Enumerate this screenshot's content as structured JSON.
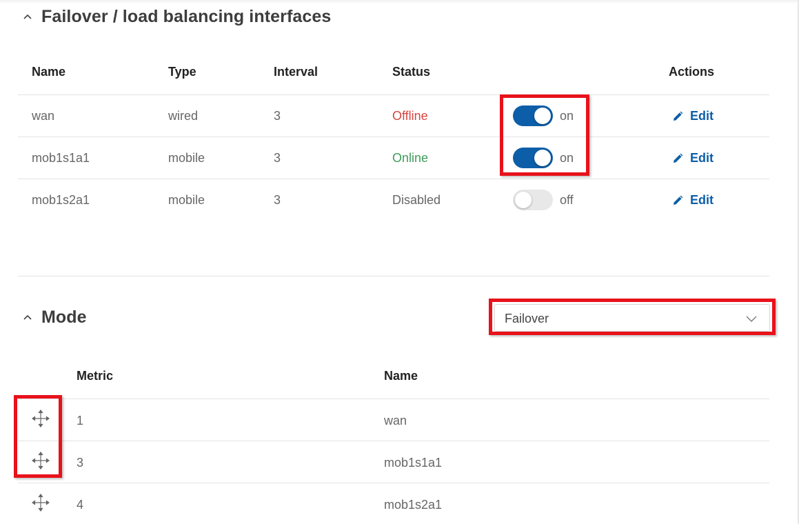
{
  "failover_section": {
    "title": "Failover / load balancing interfaces",
    "columns": {
      "name": "Name",
      "type": "Type",
      "interval": "Interval",
      "status": "Status",
      "actions": "Actions"
    },
    "rows": [
      {
        "name": "wan",
        "type": "wired",
        "interval": "3",
        "status": "Offline",
        "toggle": "on",
        "enabled": true,
        "edit": "Edit"
      },
      {
        "name": "mob1s1a1",
        "type": "mobile",
        "interval": "3",
        "status": "Online",
        "toggle": "on",
        "enabled": true,
        "edit": "Edit"
      },
      {
        "name": "mob1s2a1",
        "type": "mobile",
        "interval": "3",
        "status": "Disabled",
        "toggle": "off",
        "enabled": false,
        "edit": "Edit"
      }
    ]
  },
  "mode_section": {
    "title": "Mode",
    "select_value": "Failover",
    "columns": {
      "metric": "Metric",
      "name": "Name"
    },
    "rows": [
      {
        "metric": "1",
        "name": "wan"
      },
      {
        "metric": "3",
        "name": "mob1s1a1"
      },
      {
        "metric": "4",
        "name": "mob1s2a1"
      }
    ]
  },
  "colors": {
    "accent": "#0c5ea8",
    "offline": "#d64541",
    "online": "#3f9c5a",
    "highlight": "#e8121b"
  },
  "icons": {
    "collapse": "chevron-up-icon",
    "edit": "pencil-icon",
    "select": "chevron-down-icon",
    "drag": "move-arrows-icon"
  }
}
